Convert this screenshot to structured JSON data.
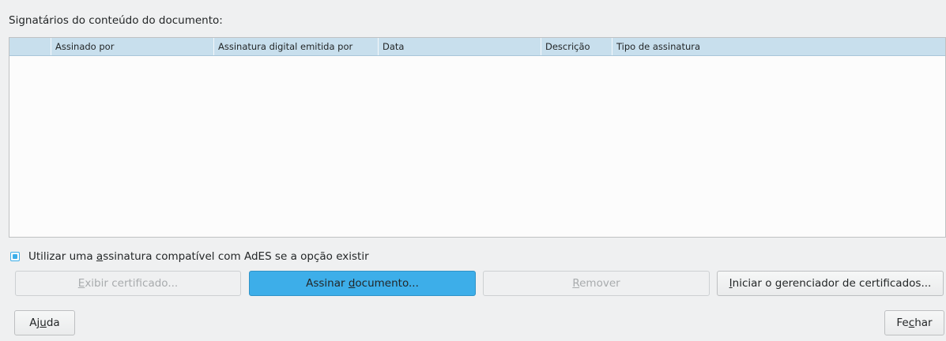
{
  "section": {
    "heading": "Signatários do conteúdo do documento:"
  },
  "table": {
    "columns": [
      "",
      "Assinado por",
      "Assinatura digital emitida por",
      "Data",
      "Descrição",
      "Tipo de assinatura"
    ],
    "rows": []
  },
  "options": {
    "ades_label_pre": "Utilizar uma ",
    "ades_label_mnemonic": "a",
    "ades_label_post": "ssinatura compatível com AdES se a opção existir",
    "ades_checked": true
  },
  "buttons": {
    "view_pre": "",
    "view_mnemonic": "E",
    "view_post": "xibir certificado...",
    "sign_pre": "Assinar ",
    "sign_mnemonic": "d",
    "sign_post": "ocumento...",
    "remove_pre": "",
    "remove_mnemonic": "R",
    "remove_post": "emover",
    "manager_pre": "",
    "manager_mnemonic": "I",
    "manager_post": "niciar o gerenciador de certificados...",
    "help_pre": "Aj",
    "help_mnemonic": "u",
    "help_post": "da",
    "close_pre": "Fe",
    "close_mnemonic": "c",
    "close_post": "har"
  },
  "colors": {
    "accent": "#3daee9",
    "header_bg": "#c8dfed",
    "window_bg": "#eff0f1"
  }
}
